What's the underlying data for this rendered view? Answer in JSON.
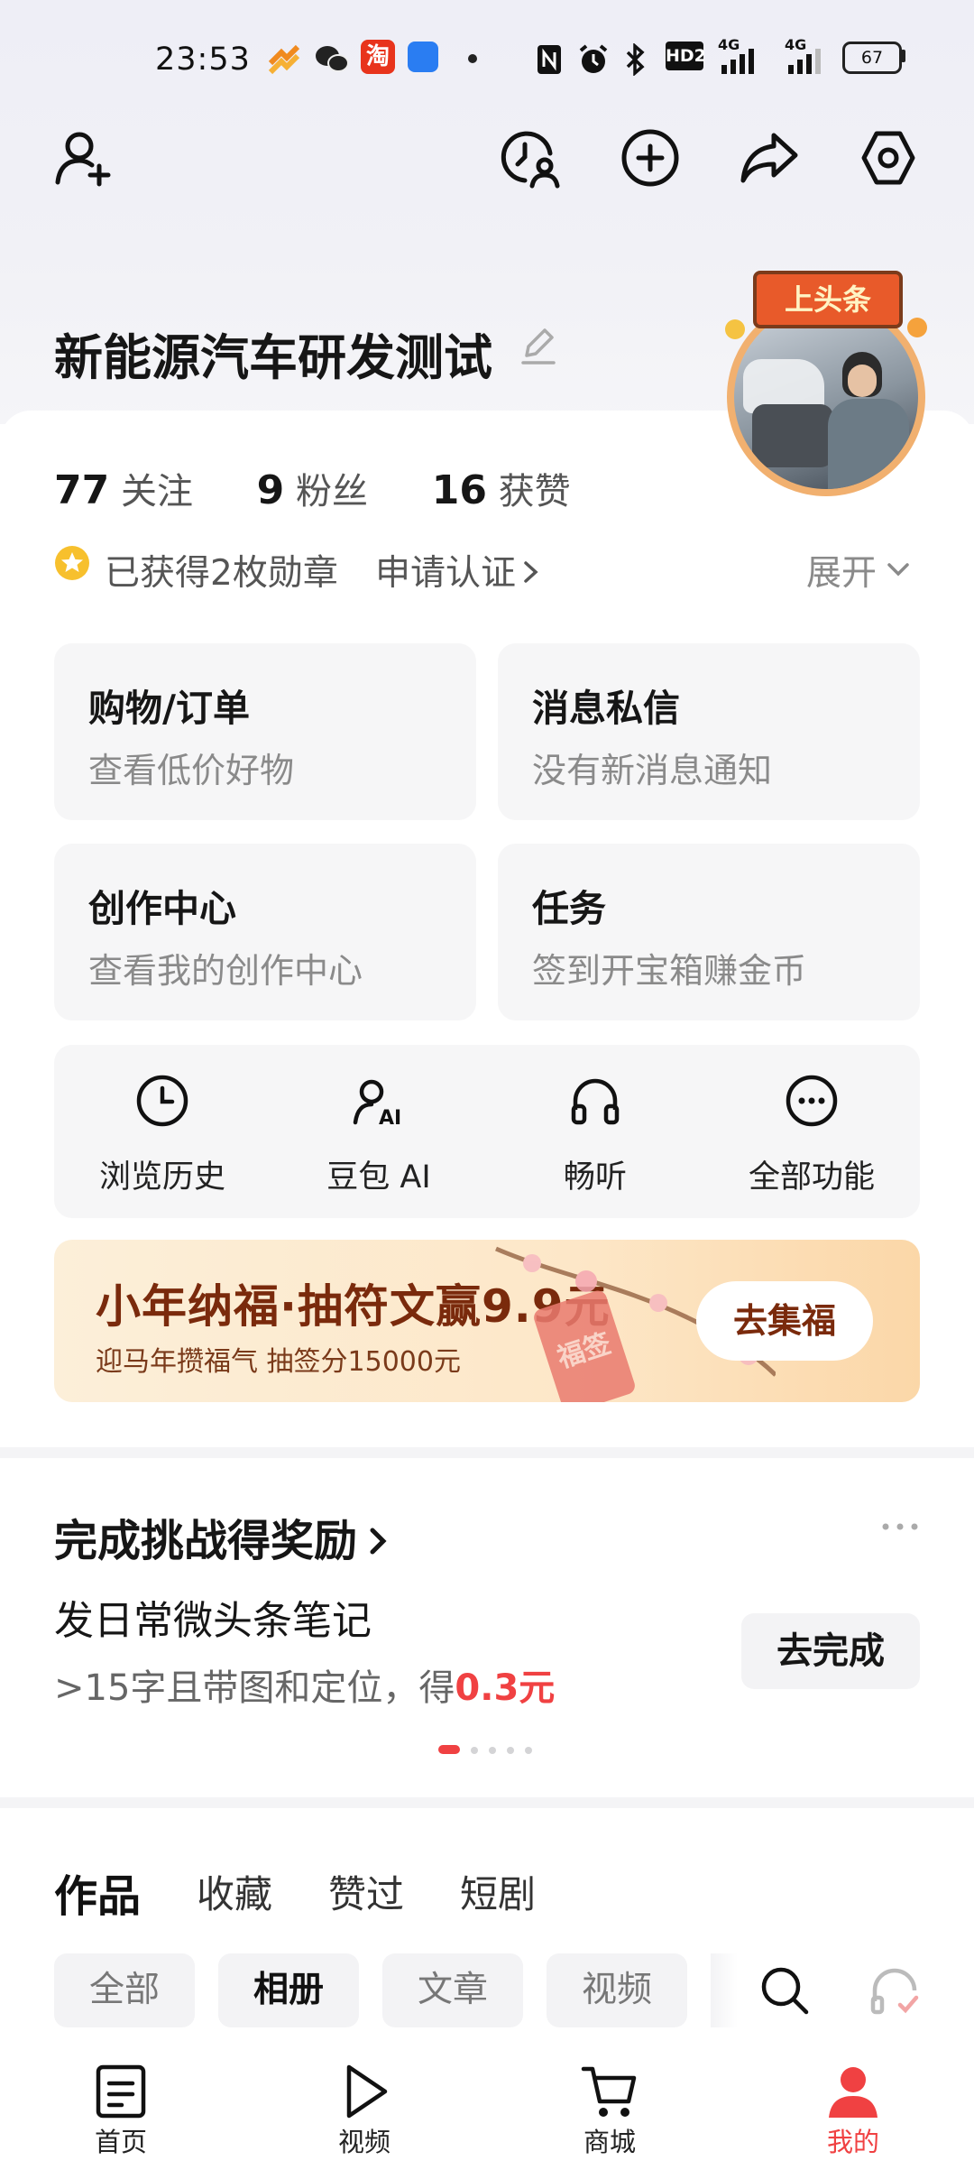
{
  "status_bar": {
    "time": "23:53",
    "hd": "HD2",
    "sig1": "4G",
    "sig2": "4G",
    "battery": "67"
  },
  "profile": {
    "username": "新能源汽车研发测试",
    "avatar_badge": "上头条",
    "following_count": "77",
    "following_label": "关注",
    "fans_count": "9",
    "fans_label": "粉丝",
    "likes_count": "16",
    "likes_label": "获赞",
    "medals_text": "已获得2枚勋章",
    "verify_link": "申请认证",
    "expand_label": "展开"
  },
  "tiles": [
    {
      "title": "购物/订单",
      "subtitle": "查看低价好物"
    },
    {
      "title": "消息私信",
      "subtitle": "没有新消息通知"
    },
    {
      "title": "创作中心",
      "subtitle": "查看我的创作中心"
    },
    {
      "title": "任务",
      "subtitle": "签到开宝箱赚金币"
    }
  ],
  "tools": [
    {
      "label": "浏览历史",
      "icon": "clock-icon"
    },
    {
      "label": "豆包 AI",
      "icon": "doubao-ai-icon"
    },
    {
      "label": "畅听",
      "icon": "headphones-icon"
    },
    {
      "label": "全部功能",
      "icon": "more-circle-icon"
    }
  ],
  "banner": {
    "title": "小年纳福·抽符文赢9.9元",
    "subtitle": "迎马年攒福气 抽签分15000元",
    "button": "去集福",
    "charm_text": "福签"
  },
  "challenge": {
    "heading": "完成挑战得奖励",
    "task_title": "发日常微头条笔记",
    "task_desc": ">15字且带图和定位，得",
    "reward": "0.3元",
    "button": "去完成",
    "page_index": 1,
    "page_count": 5
  },
  "content_tabs": [
    "作品",
    "收藏",
    "赞过",
    "短剧"
  ],
  "active_content_tab": "作品",
  "sub_tabs": [
    "全部",
    "相册",
    "文章",
    "视频"
  ],
  "active_sub_tab": "相册",
  "bottom_nav": [
    {
      "label": "首页",
      "icon": "home-doc-icon"
    },
    {
      "label": "视频",
      "icon": "play-icon"
    },
    {
      "label": "商城",
      "icon": "cart-icon"
    },
    {
      "label": "我的",
      "icon": "person-icon"
    }
  ],
  "colors": {
    "accent_red": "#f04142",
    "reward_red": "#f04142",
    "banner_title": "#7a2a0c"
  }
}
